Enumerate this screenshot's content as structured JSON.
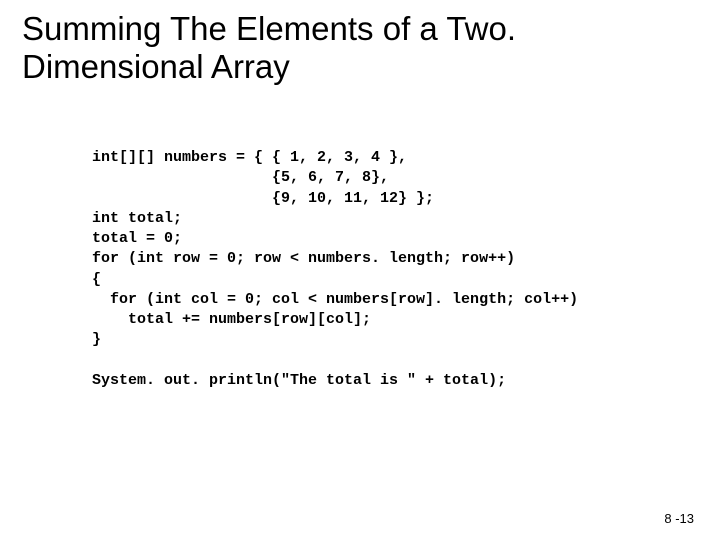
{
  "title": "Summing The Elements of a Two. Dimensional Array",
  "code": "int[][] numbers = { { 1, 2, 3, 4 },\n                    {5, 6, 7, 8},\n                    {9, 10, 11, 12} };\nint total;\ntotal = 0;\nfor (int row = 0; row < numbers. length; row++)\n{\n  for (int col = 0; col < numbers[row]. length; col++)\n    total += numbers[row][col];\n}\n\nSystem. out. println(\"The total is \" + total);",
  "page_number": "8 -13"
}
